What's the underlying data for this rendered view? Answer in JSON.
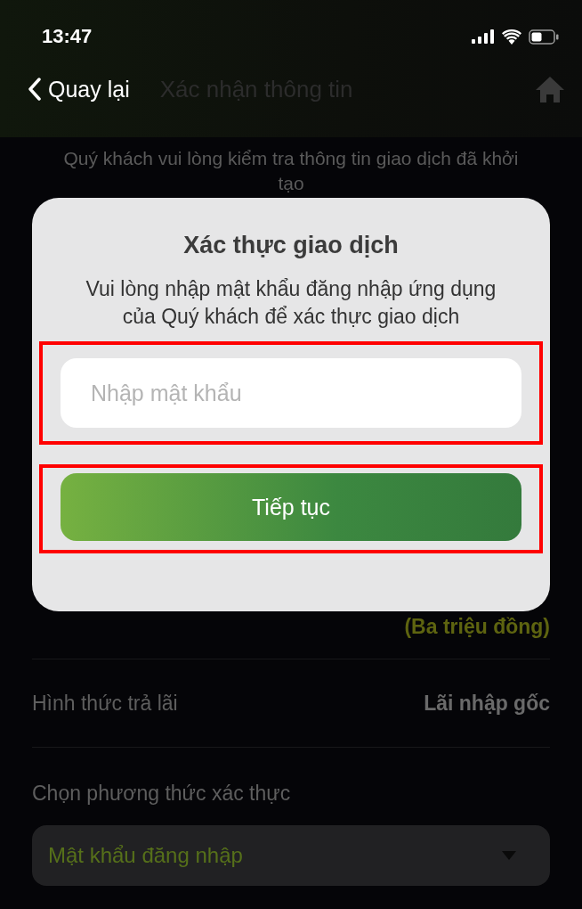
{
  "status_bar": {
    "time": "13:47"
  },
  "nav_bar": {
    "back_label": "Quay lại",
    "title": "Xác nhận thông tin"
  },
  "intro": "Quý khách vui lòng kiểm tra thông tin giao dịch đã khởi tạo",
  "amount_in_words": "(Ba triệu đồng)",
  "rows": [
    {
      "label": "Hình thức trả lãi",
      "value": "Lãi nhập gốc"
    }
  ],
  "auth_method": {
    "label": "Chọn phương thức xác thực",
    "value": "Mật khẩu đăng nhập"
  },
  "dialog": {
    "title": "Xác thực giao dịch",
    "message": "Vui lòng nhập mật khẩu đăng nhập ứng dụng của Quý khách để xác thực giao dịch",
    "password_field": {
      "placeholder": "Nhập mật khẩu",
      "highlighted": true
    },
    "button": {
      "label": "Tiếp tục",
      "highlighted": true
    }
  }
}
